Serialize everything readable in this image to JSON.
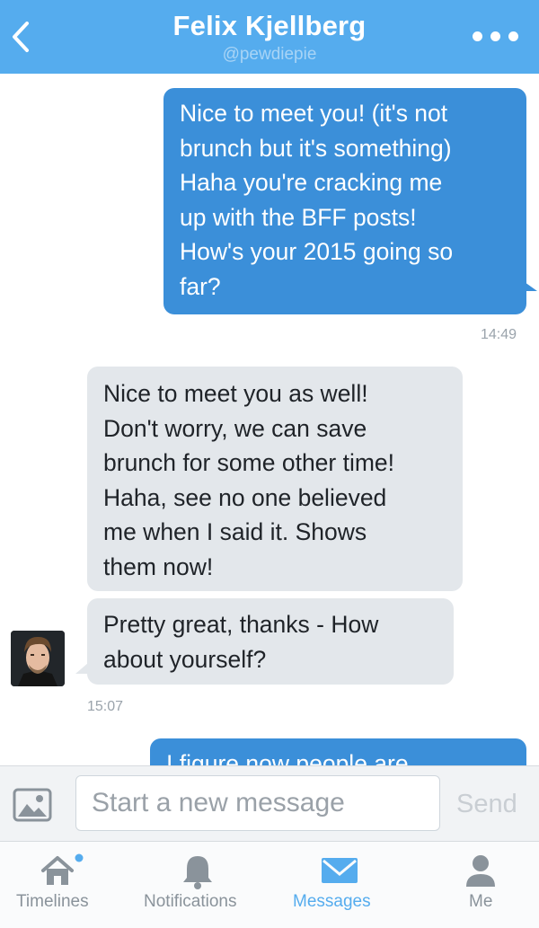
{
  "header": {
    "title": "Felix Kjellberg",
    "handle": "@pewdiepie"
  },
  "messages": [
    {
      "direction": "outgoing",
      "lines": [
        "Nice to meet you! (it's not",
        "brunch but it's something)",
        "Haha you're cracking me",
        "up with the BFF posts!",
        "How's your 2015 going so",
        "far?"
      ],
      "time": "14:49"
    },
    {
      "direction": "incoming",
      "lines": [
        "Nice to meet you as well!",
        "Don't worry, we can save",
        "brunch for some other time!",
        "Haha, see no one believed",
        "me when I said it. Shows",
        "them now!"
      ]
    },
    {
      "direction": "incoming",
      "lines": [
        "Pretty great, thanks - How",
        "about yourself?"
      ],
      "time": "15:07"
    },
    {
      "direction": "outgoing",
      "lines": [
        "I figure now people are"
      ]
    }
  ],
  "compose": {
    "placeholder": "Start a new message",
    "send_label": "Send"
  },
  "tabs": [
    {
      "label": "Timelines",
      "icon": "home-icon",
      "has_dot": true
    },
    {
      "label": "Notifications",
      "icon": "bell-icon"
    },
    {
      "label": "Messages",
      "icon": "envelope-icon",
      "active": true
    },
    {
      "label": "Me",
      "icon": "person-icon"
    }
  ],
  "colors": {
    "accent": "#55acee",
    "outgoing_bubble": "#3b8fd9",
    "incoming_bubble": "#e3e7eb"
  }
}
